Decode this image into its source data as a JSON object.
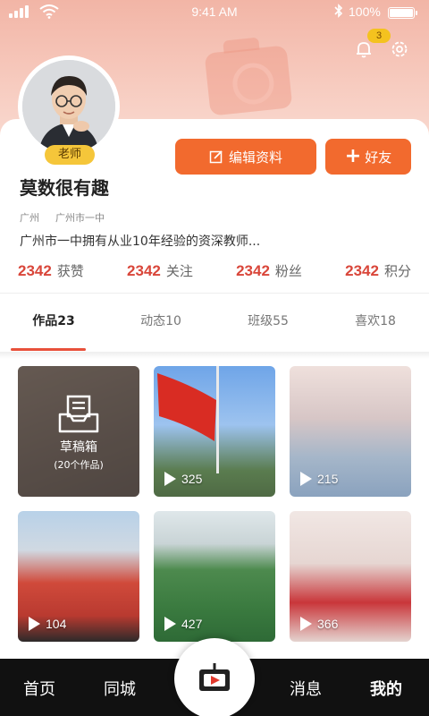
{
  "status_bar": {
    "time": "9:41 AM",
    "battery": "100%"
  },
  "header": {
    "notification_count": "3"
  },
  "profile": {
    "role": "老师",
    "name": "莫数很有趣",
    "locations": [
      "广州",
      "广州市一中"
    ],
    "bio": "广州市一中拥有从业10年经验的资深教师...",
    "edit_label": "编辑资料",
    "friend_label": "好友",
    "stats": [
      {
        "num": "2342",
        "label": "获赞"
      },
      {
        "num": "2342",
        "label": "关注"
      },
      {
        "num": "2342",
        "label": "粉丝"
      },
      {
        "num": "2342",
        "label": "积分"
      }
    ]
  },
  "tabs": [
    "作品23",
    "动态10",
    "班级55",
    "喜欢18"
  ],
  "drafts": {
    "title": "草稿箱",
    "count": "(20个作品)"
  },
  "videos": [
    "325",
    "215",
    "104",
    "427",
    "366"
  ],
  "nav": {
    "home": "首页",
    "city": "同城",
    "messages": "消息",
    "me": "我的"
  },
  "colors": {
    "accent": "#f26a2e",
    "stat": "#d9463a",
    "badge": "#f5c63a"
  }
}
